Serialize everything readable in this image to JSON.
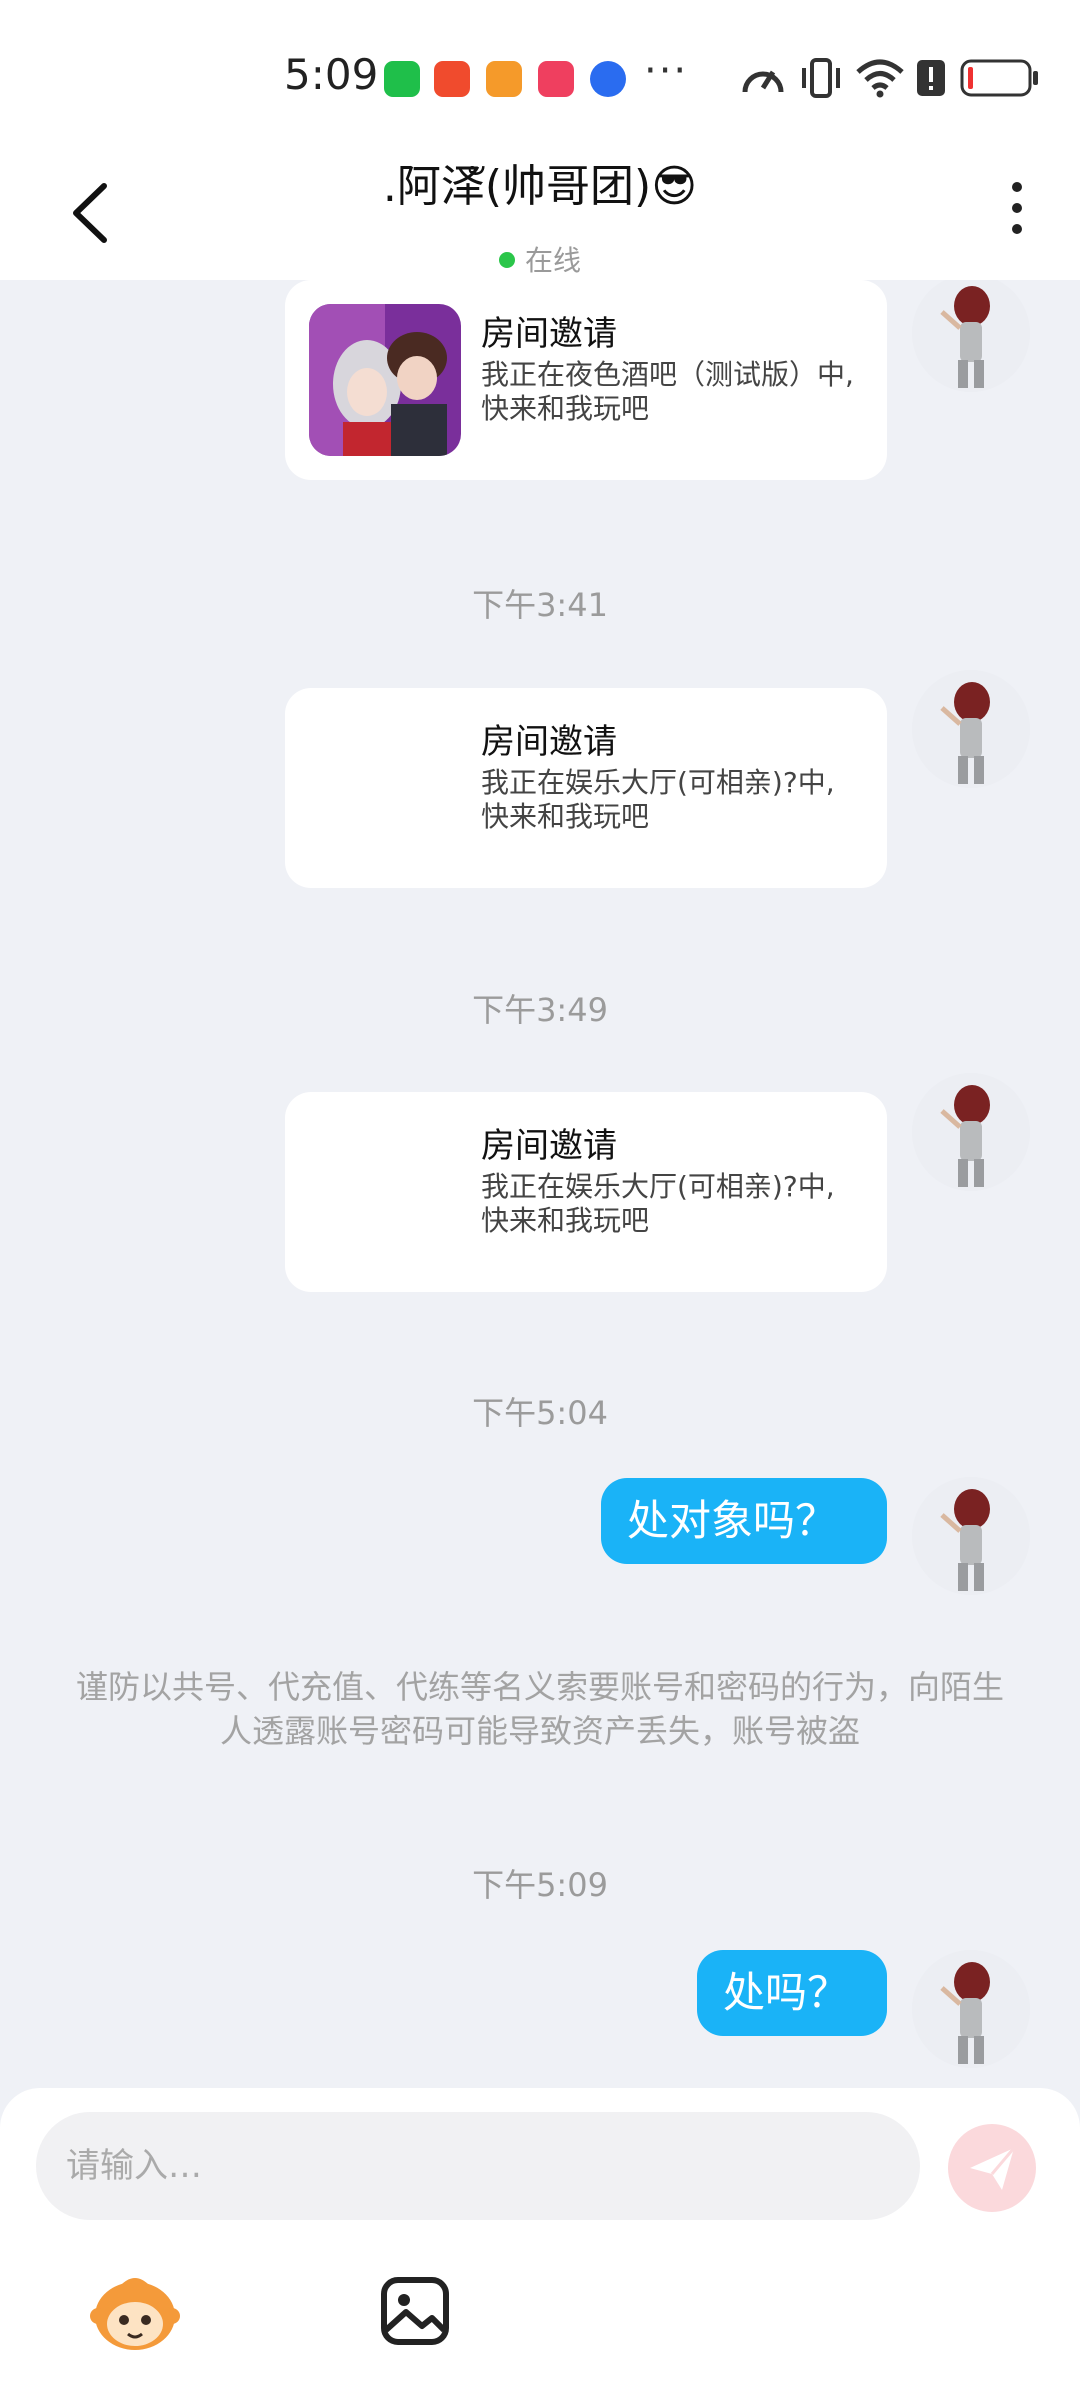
{
  "status_bar": {
    "time": "5:09",
    "app_icons": [
      "wechat-icon",
      "battery-saver-icon",
      "heart-app-icon",
      "tiktok-icon",
      "baidu-icon"
    ],
    "app_icon_colors": [
      "#1fbf4a",
      "#f04b2d",
      "#f59a2a",
      "#ef3f5f",
      "#2a6cf0"
    ],
    "more": "···",
    "right_icons": [
      "speedometer-icon",
      "vibrate-icon",
      "wifi-icon",
      "alert-icon",
      "battery-low-icon"
    ]
  },
  "header": {
    "back_icon": "back-arrow-icon",
    "title": ".阿泽ั(帅哥团)😎",
    "status": "在线",
    "status_color": "#2bc64a",
    "more_icon": "more-vertical-icon"
  },
  "messages": [
    {
      "kind": "invite",
      "title": "房间邀请",
      "desc": "我正在夜色酒吧（测试版）中, 快来和我玩吧",
      "has_thumb": true
    },
    {
      "kind": "time",
      "text": "下午3:41"
    },
    {
      "kind": "invite",
      "title": "房间邀请",
      "desc": "我正在娱乐大厅(可相亲)?中, 快来和我玩吧",
      "has_thumb": false
    },
    {
      "kind": "time",
      "text": "下午3:49"
    },
    {
      "kind": "invite",
      "title": "房间邀请",
      "desc": "我正在娱乐大厅(可相亲)?中, 快来和我玩吧",
      "has_thumb": false
    },
    {
      "kind": "time",
      "text": "下午5:04"
    },
    {
      "kind": "text",
      "text": "处对象吗？"
    },
    {
      "kind": "notice",
      "text": "谨防以共号、代充值、代练等名义索要账号和密码的行为，向陌生人透露账号密码可能导致资产丢失，账号被盗"
    },
    {
      "kind": "time",
      "text": "下午5:09"
    },
    {
      "kind": "text",
      "text": "处吗？"
    }
  ],
  "input": {
    "placeholder": "请输入…",
    "send_icon": "send-icon",
    "send_color": "#fbd9dc"
  },
  "toolbar": [
    "emoji-mascot-icon",
    "image-icon"
  ],
  "colors": {
    "bubble": "#1ab3f7",
    "background": "#eff1f6"
  }
}
